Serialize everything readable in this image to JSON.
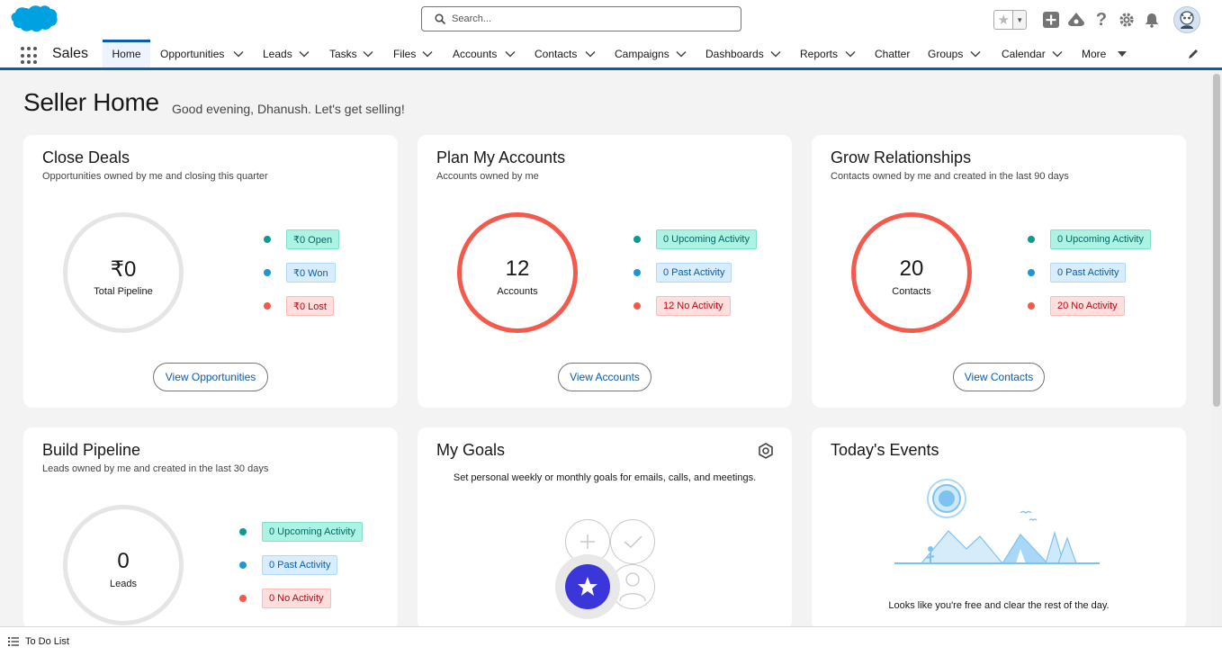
{
  "header": {
    "search_placeholder": "Search...",
    "app_name": "Sales"
  },
  "nav": {
    "items": [
      {
        "label": "Home"
      },
      {
        "label": "Opportunities"
      },
      {
        "label": "Leads"
      },
      {
        "label": "Tasks"
      },
      {
        "label": "Files"
      },
      {
        "label": "Accounts"
      },
      {
        "label": "Contacts"
      },
      {
        "label": "Campaigns"
      },
      {
        "label": "Dashboards"
      },
      {
        "label": "Reports"
      },
      {
        "label": "Chatter"
      },
      {
        "label": "Groups"
      },
      {
        "label": "Calendar"
      },
      {
        "label": "More"
      }
    ]
  },
  "page": {
    "title": "Seller Home",
    "greeting": "Good evening, Dhanush. Let's get selling!"
  },
  "close_deals": {
    "title": "Close Deals",
    "subtitle": "Opportunities owned by me and closing this quarter",
    "value": "₹0",
    "value_label": "Total Pipeline",
    "open": "₹0 Open",
    "won": "₹0 Won",
    "lost": "₹0 Lost",
    "button": "View Opportunities"
  },
  "plan_accounts": {
    "title": "Plan My Accounts",
    "subtitle": "Accounts owned by me",
    "value": "12",
    "value_label": "Accounts",
    "upcoming": "0 Upcoming Activity",
    "past": "0 Past Activity",
    "none": "12 No Activity",
    "button": "View Accounts"
  },
  "grow_relationships": {
    "title": "Grow Relationships",
    "subtitle": "Contacts owned by me and created in the last 90 days",
    "value": "20",
    "value_label": "Contacts",
    "upcoming": "0 Upcoming Activity",
    "past": "0 Past Activity",
    "none": "20 No Activity",
    "button": "View Contacts"
  },
  "build_pipeline": {
    "title": "Build Pipeline",
    "subtitle": "Leads owned by me and created in the last 30 days",
    "value": "0",
    "value_label": "Leads",
    "upcoming": "0 Upcoming Activity",
    "past": "0 Past Activity",
    "none": "0 No Activity"
  },
  "my_goals": {
    "title": "My Goals",
    "description": "Set personal weekly or monthly goals for emails, calls, and meetings."
  },
  "todays_events": {
    "title": "Today's Events",
    "message": "Looks like you're free and clear the rest of the day."
  },
  "utility": {
    "todo_label": "To Do List"
  },
  "colors": {
    "brand_blue": "#0b5cab",
    "ring_red": "#f4594c",
    "ring_grey": "#e5e5e5",
    "teal_dot": "#0b9c8f",
    "blue_dot": "#1b96d6",
    "red_dot": "#f4594c"
  }
}
